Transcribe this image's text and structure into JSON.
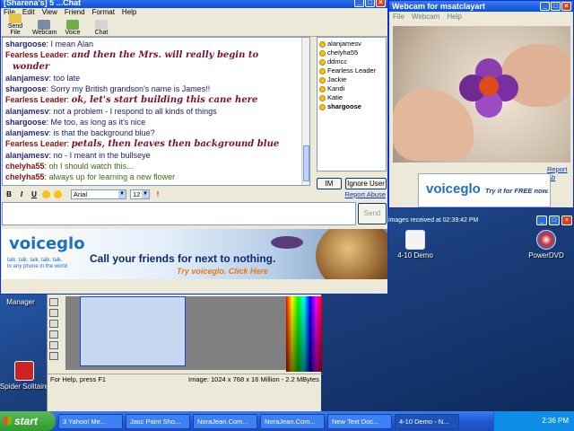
{
  "chat_window": {
    "title": "[Sharena's] 5 ...Chat",
    "menu": [
      "File",
      "Edit",
      "View",
      "Friend",
      "Format",
      "Help"
    ],
    "toolbar": [
      "Send File",
      "Webcam",
      "Voice",
      "Chat"
    ],
    "messages": [
      {
        "who": "shargoose",
        "text": "I mean Alan",
        "cls": "s",
        "style": "normal"
      },
      {
        "who": "Fearless Leader",
        "text": "and then the Mrs. will really begin to",
        "cls": "f",
        "style": "fancy"
      },
      {
        "who": "",
        "text": "wonder",
        "cls": "f",
        "style": "fancy"
      },
      {
        "who": "alanjamesv",
        "text": "too late",
        "cls": "a",
        "style": "normal"
      },
      {
        "who": "shargoose",
        "text": "Sorry my British grandson's name is James!!",
        "cls": "s",
        "style": "normal"
      },
      {
        "who": "Fearless Leader",
        "text": "ok, let's start building this cane here",
        "cls": "f",
        "style": "fancy"
      },
      {
        "who": "alanjamesv",
        "text": "not a problem - I respond to all kinds of things",
        "cls": "a",
        "style": "normal"
      },
      {
        "who": "shargoose",
        "text": "Me too, as long as it's nice",
        "cls": "s",
        "style": "normal"
      },
      {
        "who": "alanjamesv",
        "text": "is that the background blue?",
        "cls": "a",
        "style": "normal"
      },
      {
        "who": "Fearless Leader",
        "text": "petals, then leaves then background blue",
        "cls": "f",
        "style": "fancy"
      },
      {
        "who": "alanjamesv",
        "text": "no - I meant in the bullseye",
        "cls": "a",
        "style": "normal"
      },
      {
        "who": "chelyha55",
        "text": "oh I should watch this...",
        "cls": "c",
        "style": "green"
      },
      {
        "who": "chelyha55",
        "text": "always up for learning a new flower",
        "cls": "c",
        "style": "green"
      }
    ],
    "buddies": [
      "alanjamesv",
      "chelyha55",
      "ddmcc",
      "Fearless Leader",
      "Jackie",
      "Kandi",
      "Katie",
      "shargoose"
    ],
    "im_button": "IM",
    "ignore_button": "Ignore User",
    "report_abuse": "Report Abuse",
    "format": {
      "bold": "B",
      "italic": "I",
      "underline": "U",
      "font": "Arial",
      "size": "12"
    },
    "send_button": "Send"
  },
  "chat_ad": {
    "logo": "voiceglo",
    "tagline": "talk. talk. talk. talk. talk.",
    "tagline2": "to any phone in the world",
    "headline": "Call your friends for next to nothing.",
    "cta": "Try voiceglo. Click Here"
  },
  "webcam_window": {
    "title": "Webcam for msatclayart",
    "menu": [
      "File",
      "Webcam",
      "Help"
    ],
    "report_abuse": "Report Ab",
    "ad_logo": "voiceglo",
    "ad_cta": "Try it for FREE now."
  },
  "floater_text": "images received at 02:39:42 PM",
  "paint_shop": {
    "status_help": "For Help, press F1",
    "status_image": "Image:  1024 x 768 x 16 Million - 2.2 MBytes"
  },
  "desktop_icons": [
    {
      "label": "4-10 Demo"
    },
    {
      "label": "PowerDVD"
    },
    {
      "label": "Spider Solitaire"
    },
    {
      "label": "Manager"
    }
  ],
  "taskbar": {
    "start": "start",
    "tasks": [
      "3 Yahoo! Me...",
      "Jasc Paint Sho...",
      "NoraJean.Com...",
      "NoraJean.Com...",
      "New Text Doc...",
      "4-10 Demo - N..."
    ],
    "clock": "2:36 PM"
  },
  "colors": {
    "title_blue": "#0a4fd6",
    "chat_red": "#8a1010",
    "chat_blue": "#1a1a66",
    "voiceglo_blue": "#1d6fbf",
    "start_green": "#2f9a2f"
  }
}
